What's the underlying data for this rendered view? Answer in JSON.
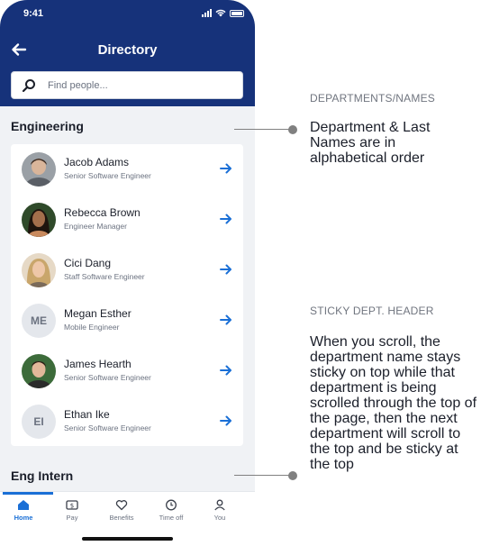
{
  "status": {
    "time": "9:41"
  },
  "header": {
    "title": "Directory"
  },
  "search": {
    "placeholder": "Find people..."
  },
  "departments": [
    {
      "name": "Engineering",
      "people": [
        {
          "name": "Jacob Adams",
          "role": "Senior Software Engineer",
          "initials": "",
          "photo": true
        },
        {
          "name": "Rebecca Brown",
          "role": "Engineer Manager",
          "initials": "",
          "photo": true
        },
        {
          "name": "Cici Dang",
          "role": "Staff Software Engineer",
          "initials": "",
          "photo": true
        },
        {
          "name": "Megan Esther",
          "role": "Mobile Engineer",
          "initials": "ME",
          "photo": false
        },
        {
          "name": "James Hearth",
          "role": "Senior Software Engineer",
          "initials": "",
          "photo": true
        },
        {
          "name": "Ethan Ike",
          "role": "Senior Software Engineer",
          "initials": "EI",
          "photo": false
        }
      ]
    },
    {
      "name": "Eng Intern",
      "people": []
    }
  ],
  "tabs": [
    {
      "label": "Home",
      "icon": "home-icon",
      "active": true
    },
    {
      "label": "Pay",
      "icon": "pay-icon",
      "active": false
    },
    {
      "label": "Benefits",
      "icon": "heart-icon",
      "active": false
    },
    {
      "label": "Time off",
      "icon": "clock-icon",
      "active": false
    },
    {
      "label": "You",
      "icon": "user-icon",
      "active": false
    }
  ],
  "annotations": [
    {
      "caption": "DEPARTMENTS/NAMES",
      "text": "Department & Last Names are in alphabetical order"
    },
    {
      "caption": "STICKY DEPT. HEADER",
      "text": "When you scroll, the department name stays sticky on top while that department is being scrolled through the top of the page, then the next department will scroll to the top and be sticky at the top"
    }
  ],
  "colors": {
    "header": "#16327a",
    "accent": "#1a6fd6",
    "background": "#f0f2f5"
  }
}
